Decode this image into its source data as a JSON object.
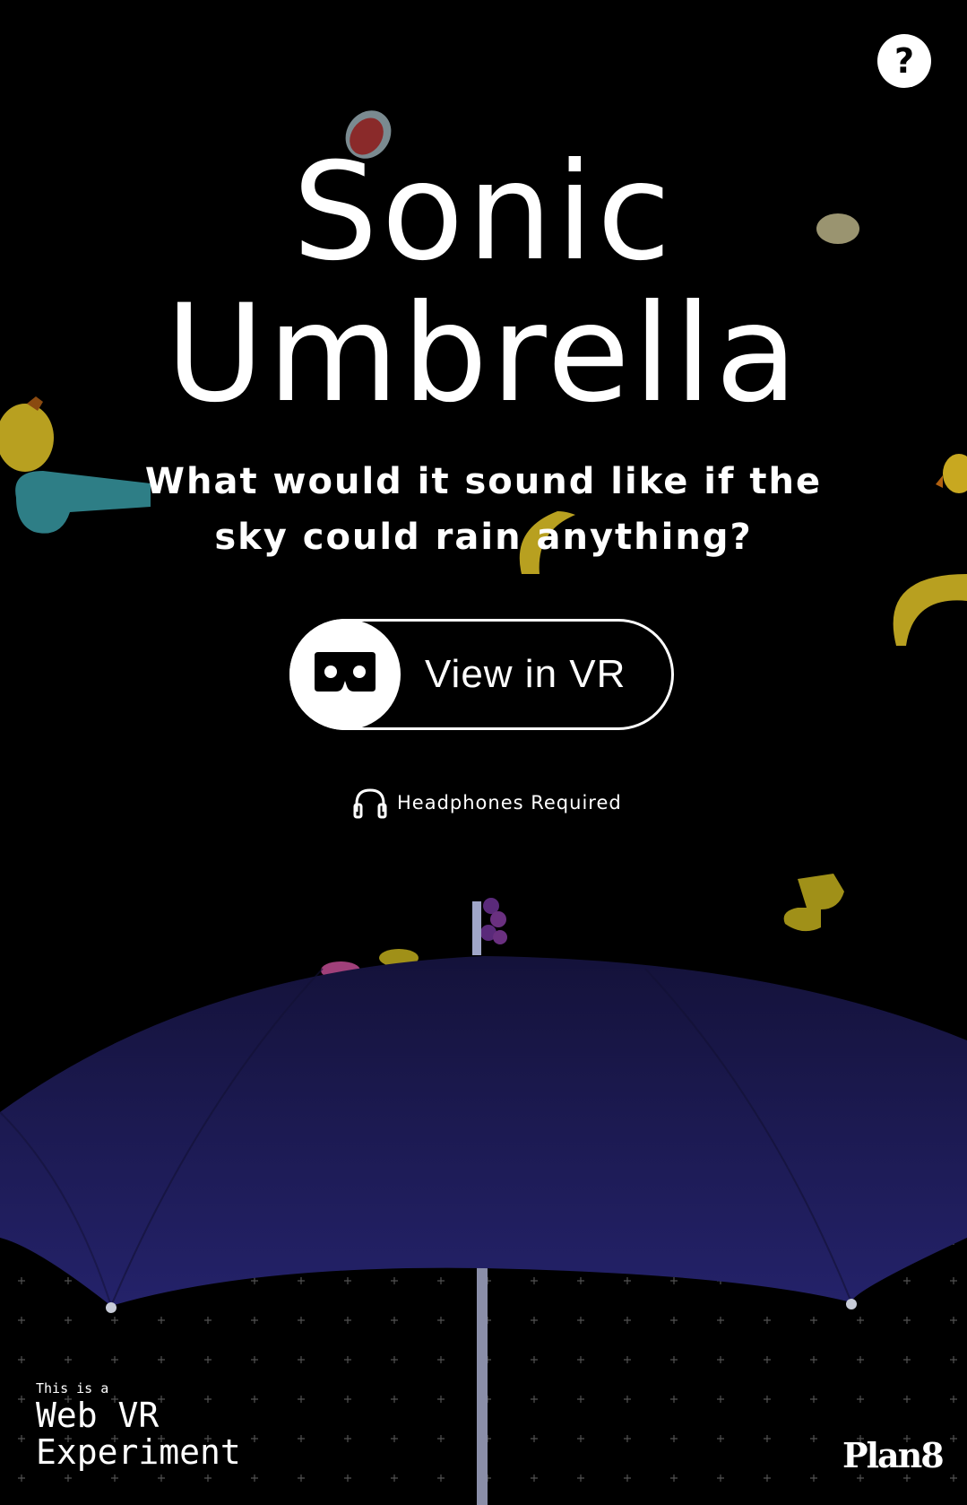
{
  "help": {
    "label": "?"
  },
  "title": {
    "line1": "Sonic",
    "line2": "Umbrella"
  },
  "tagline": "What would it sound like if the sky could rain anything?",
  "vr_button": {
    "label": "View in VR"
  },
  "headphones": {
    "label": "Headphones Required"
  },
  "badge": {
    "small": "This is a",
    "line1": "Web VR",
    "line2": "Experiment"
  },
  "logo": "Plan8",
  "colors": {
    "background": "#000000",
    "umbrella": "#1f1c52",
    "text": "#ffffff"
  }
}
